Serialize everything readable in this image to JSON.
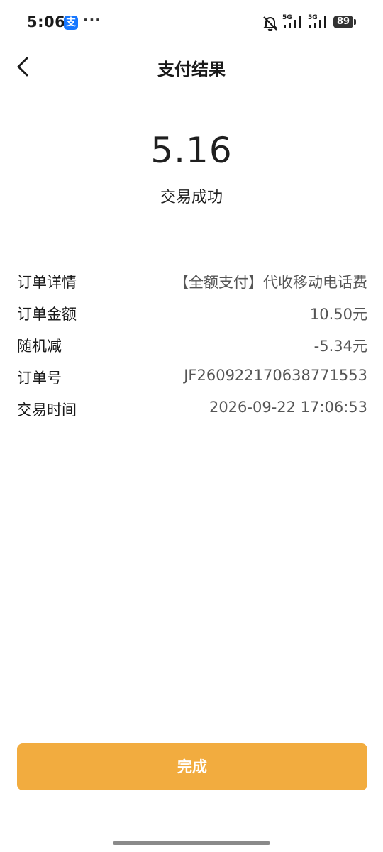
{
  "status_bar": {
    "time": "5:06",
    "app_icon_glyph": "支",
    "more": "···",
    "net1": "5G",
    "net2": "5G",
    "battery": "89"
  },
  "header": {
    "title": "支付结果"
  },
  "result": {
    "amount": "5.16",
    "status": "交易成功"
  },
  "details": [
    {
      "label": "订单详情",
      "value": "【全额支付】代收移动电话费"
    },
    {
      "label": "订单金额",
      "value": "10.50元"
    },
    {
      "label": "随机减",
      "value": "-5.34元"
    },
    {
      "label": "订单号",
      "value": "JF260922170638771553"
    },
    {
      "label": "交易时间",
      "value": "2026-09-22 17:06:53"
    }
  ],
  "actions": {
    "done_label": "完成"
  },
  "icons": {
    "back": "back-arrow-icon",
    "mute": "bell-off-icon",
    "signal": "cellular-signal-icon",
    "battery": "battery-icon",
    "app": "alipay-icon"
  },
  "colors": {
    "accent": "#f2ac3f",
    "alipay_blue": "#1677ff"
  }
}
